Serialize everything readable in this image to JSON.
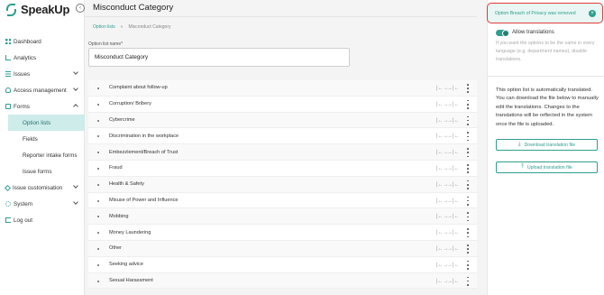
{
  "app": {
    "name": "SpeakUp",
    "collapse_icon": "chevron-left-icon"
  },
  "sidebar": {
    "items": [
      {
        "label": "Dashboard",
        "icon": "dashboard-grid-icon"
      },
      {
        "label": "Analytics",
        "icon": "analytics-chart-icon"
      },
      {
        "label": "Issues",
        "icon": "issues-list-icon",
        "expandable": true
      },
      {
        "label": "Access management",
        "icon": "users-icon",
        "expandable": true
      },
      {
        "label": "Forms",
        "icon": "forms-icon",
        "expanded": true,
        "children": [
          "Option lists",
          "Fields",
          "Reporter intake forms",
          "Issue forms"
        ],
        "active_child": "Option lists"
      },
      {
        "label": "Issue customisation",
        "icon": "tool-icon",
        "expandable": true
      },
      {
        "label": "System",
        "icon": "gear-icon",
        "expandable": true
      },
      {
        "label": "Log out",
        "icon": "logout-icon"
      }
    ]
  },
  "header": {
    "title": "Misconduct Category"
  },
  "breadcrumb": {
    "parent": "Option lists",
    "separator": "»",
    "current": "Misconduct Category"
  },
  "form": {
    "name_label": "Option list name*",
    "name_value": "Misconduct Category"
  },
  "options": {
    "items": [
      "Complaint about follow-up",
      "Corruption/ Bribery",
      "Cybercrime",
      "Discrimination in the workplace",
      "Embezzlement/Breach of Trust",
      "Fraud",
      "Health & Safety",
      "Misuse of Power and Influence",
      "Mobbing",
      "Money Laundering",
      "Other",
      "Seeking advice",
      "Sexual Harassment"
    ],
    "row_action_icons": [
      "expand-icon",
      "collapse-icon",
      "more-vertical-icon"
    ]
  },
  "toast": {
    "message": "Option Breach of Privacy was removed",
    "close_icon": "close-icon"
  },
  "right_panel": {
    "toggle_label": "Allow translations",
    "toggle_on": true,
    "help_text": "If you want the options to be the same in every language (e.g. department names), disable translations.",
    "info_text": "This option list is automatically translated. You can download the file below to manually edit the translations. Changes to the translations will be reflected in the system once the file is uploaded.",
    "download_label": "Download translation file",
    "upload_label": "Upload translation file"
  },
  "colors": {
    "accent": "#2f9f8f",
    "toast_border": "#e03a3a",
    "active_bg": "#cdecea"
  }
}
